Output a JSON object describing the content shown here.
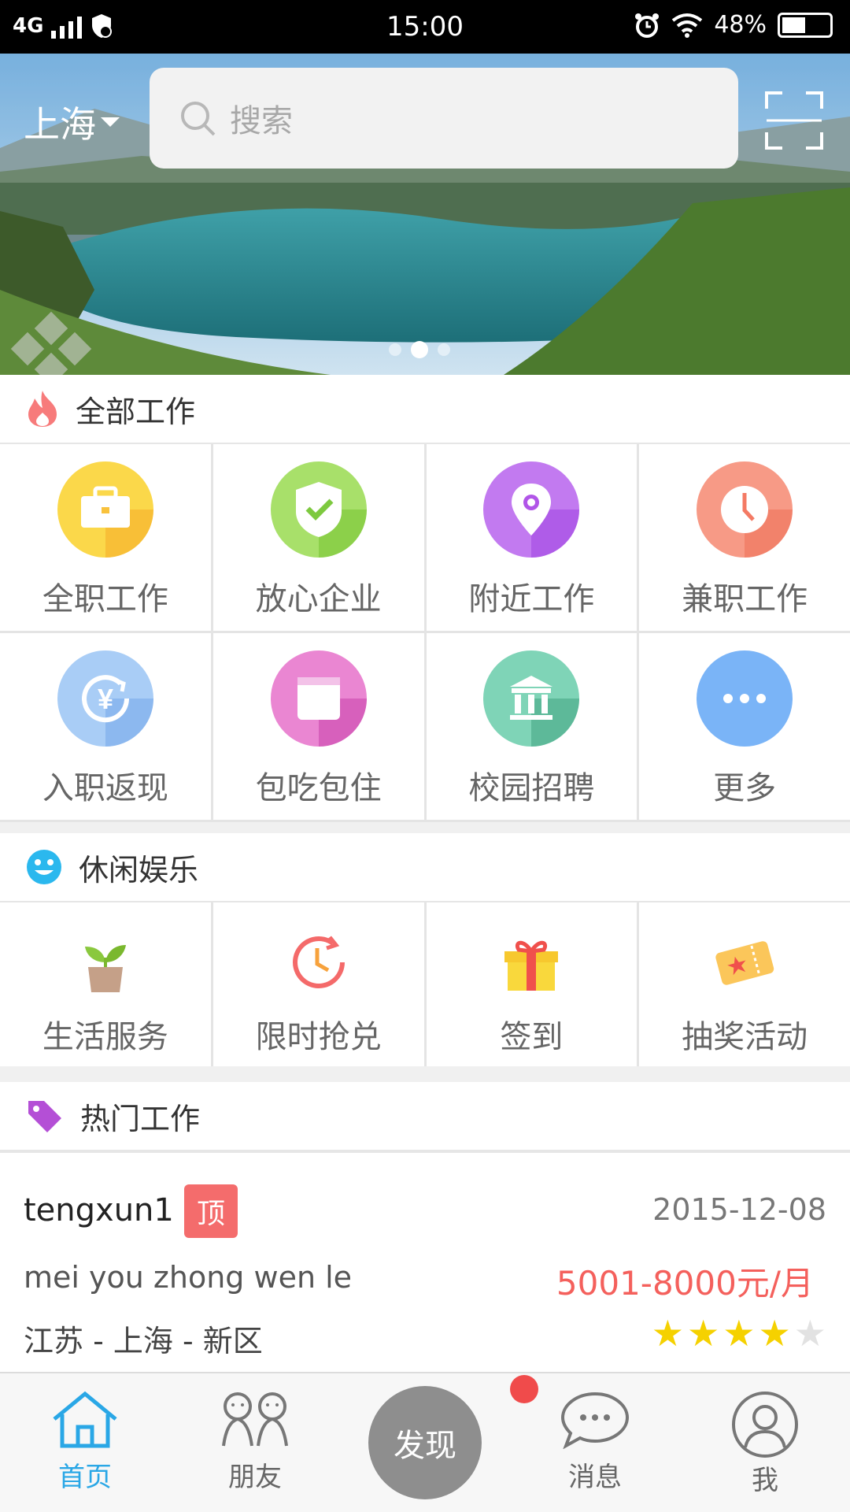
{
  "status": {
    "network": "4G",
    "time": "15:00",
    "battery": "48%"
  },
  "header": {
    "city": "上海",
    "search_placeholder": "搜索"
  },
  "banner": {
    "slide_count": 3,
    "active_slide": 2
  },
  "sections": {
    "all_jobs": {
      "title": "全部工作",
      "items": [
        {
          "label": "全职工作",
          "icon": "briefcase-icon",
          "color": "#f9c23c"
        },
        {
          "label": "放心企业",
          "icon": "shield-check-icon",
          "color": "#8dd54a"
        },
        {
          "label": "附近工作",
          "icon": "location-pin-icon",
          "color": "#b155e8"
        },
        {
          "label": "兼职工作",
          "icon": "clock-icon",
          "color": "#f47a64"
        },
        {
          "label": "入职返现",
          "icon": "yen-cashback-icon",
          "color": "#8fb9f2"
        },
        {
          "label": "包吃包住",
          "icon": "bed-icon",
          "color": "#df5fbf"
        },
        {
          "label": "校园招聘",
          "icon": "campus-building-icon",
          "color": "#5fbf9e"
        },
        {
          "label": "更多",
          "icon": "more-dots-icon",
          "color": "#7ab4f7"
        }
      ]
    },
    "leisure": {
      "title": "休闲娱乐",
      "items": [
        {
          "label": "生活服务",
          "icon": "plant-pot-icon"
        },
        {
          "label": "限时抢兑",
          "icon": "timer-icon"
        },
        {
          "label": "签到",
          "icon": "gift-icon"
        },
        {
          "label": "抽奖活动",
          "icon": "lottery-ticket-icon"
        }
      ]
    },
    "hot_jobs": {
      "title": "热门工作"
    }
  },
  "job": {
    "title": "tengxun1",
    "badge": "顶",
    "date": "2015-12-08",
    "description": "mei you zhong wen le",
    "salary": "5001-8000元/月",
    "location": "江苏 - 上海 - 新区",
    "rating": 4,
    "rating_max": 5
  },
  "nav": {
    "home": "首页",
    "friends": "朋友",
    "discover": "发现",
    "messages": "消息",
    "me": "我"
  },
  "colors": {
    "accent": "#2aa7e6",
    "salary": "#f4605c",
    "badge": "#f46c6c"
  }
}
